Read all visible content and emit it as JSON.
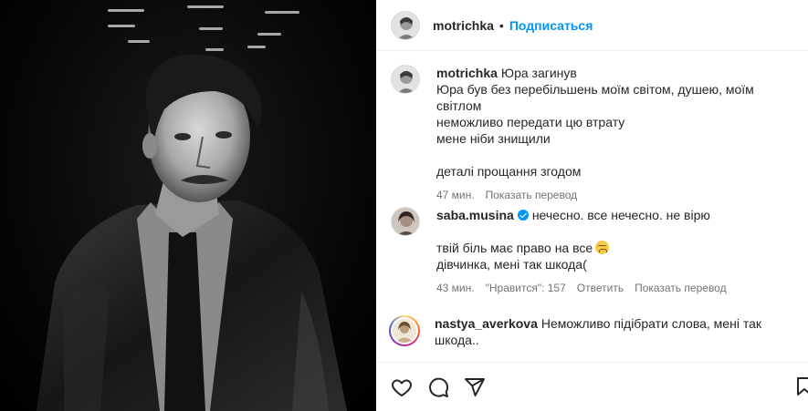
{
  "post": {
    "author": "motrichka",
    "separator": "•",
    "follow_label": "Подписаться"
  },
  "caption": {
    "username": "motrichka",
    "lines": [
      "Юра загинув",
      "Юра був без перебільшень моїм світом, душею, моїм світлом",
      "неможливо передати цю втрату",
      "мене ніби знищили",
      "",
      "деталі прощання згодом"
    ],
    "time": "47 мин.",
    "translate": "Показать перевод"
  },
  "comments": [
    {
      "username": "saba.musina",
      "verified": true,
      "lines": [
        "нечесно. все нечесно. не вірю",
        "",
        "твій біль має право на все",
        "дівчинка, мені так шкода("
      ],
      "time": "43 мин.",
      "likes": "\"Нравится\": 157",
      "reply": "Ответить",
      "translate": "Показать перевод"
    },
    {
      "username": "nastya_averkova",
      "text": "Неможливо підібрати слова, мені так шкода.."
    }
  ],
  "icons": {
    "like": "heart-icon",
    "comment": "comment-icon",
    "share": "share-icon",
    "save": "bookmark-icon"
  },
  "colors": {
    "link_blue": "#0095f6",
    "text": "#262626",
    "muted": "#737373"
  }
}
